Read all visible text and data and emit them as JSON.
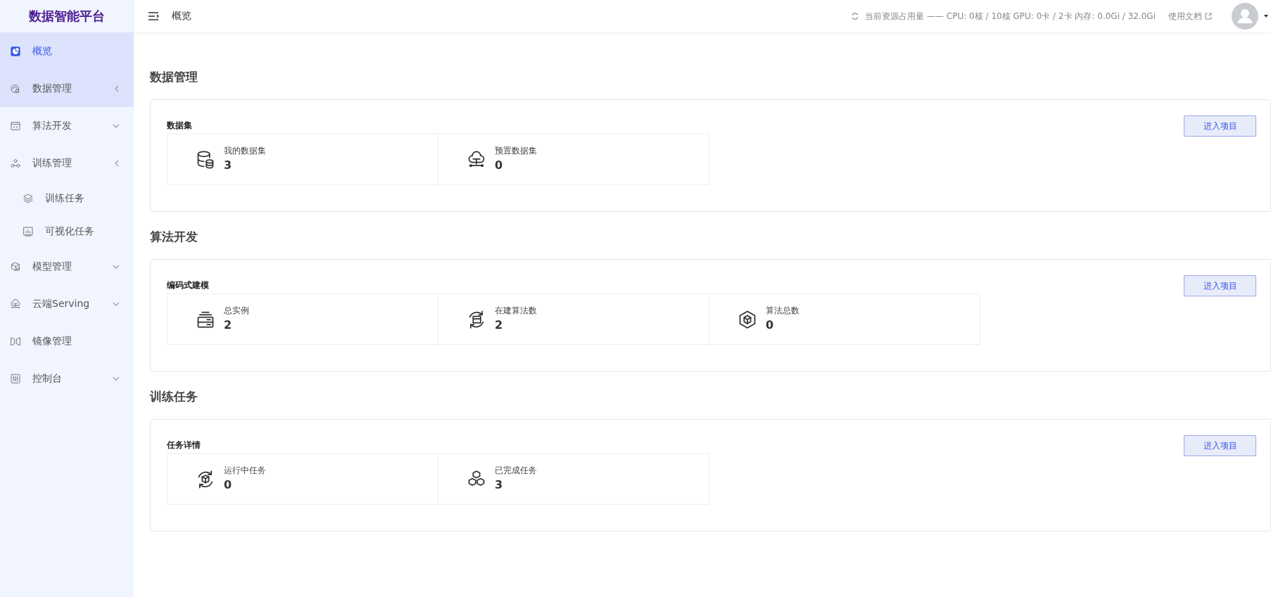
{
  "brand": "数据智能平台",
  "sidebar": {
    "items": [
      {
        "label": "概览",
        "kind": "link",
        "selected": true,
        "hovered": false
      },
      {
        "label": "数据管理",
        "kind": "group",
        "selected": false,
        "hovered": true,
        "expanded": true
      },
      {
        "label": "算法开发",
        "kind": "group",
        "selected": false,
        "hovered": false,
        "expanded": false
      },
      {
        "label": "训练管理",
        "kind": "group",
        "selected": false,
        "hovered": false,
        "expanded": true,
        "children": [
          {
            "label": "训练任务",
            "selected": false
          },
          {
            "label": "可视化任务",
            "selected": false
          }
        ]
      },
      {
        "label": "模型管理",
        "kind": "group",
        "selected": false,
        "hovered": false,
        "expanded": false
      },
      {
        "label": "云端Serving",
        "kind": "group",
        "selected": false,
        "hovered": false,
        "expanded": false
      },
      {
        "label": "镜像管理",
        "kind": "link",
        "selected": false,
        "hovered": false
      },
      {
        "label": "控制台",
        "kind": "group",
        "selected": false,
        "hovered": false,
        "expanded": false
      }
    ]
  },
  "topbar": {
    "page_title": "概览",
    "resources": "当前资源占用量 —— CPU: 0核 / 10核 GPU: 0卡 / 2卡 内存: 0.0Gi / 32.0Gi",
    "docs_link": "使用文档"
  },
  "sections": [
    {
      "title": "数据管理",
      "card_title": "数据集",
      "button": "进入项目",
      "stats": [
        {
          "label": "我的数据集",
          "value": "3"
        },
        {
          "label": "预置数据集",
          "value": "0"
        }
      ]
    },
    {
      "title": "算法开发",
      "card_title": "编码式建模",
      "button": "进入项目",
      "stats": [
        {
          "label": "总实例",
          "value": "2"
        },
        {
          "label": "在建算法数",
          "value": "2"
        },
        {
          "label": "算法总数",
          "value": "0"
        }
      ]
    },
    {
      "title": "训练任务",
      "card_title": "任务详情",
      "button": "进入项目",
      "stats": [
        {
          "label": "运行中任务",
          "value": "0"
        },
        {
          "label": "已完成任务",
          "value": "3"
        }
      ]
    }
  ]
}
